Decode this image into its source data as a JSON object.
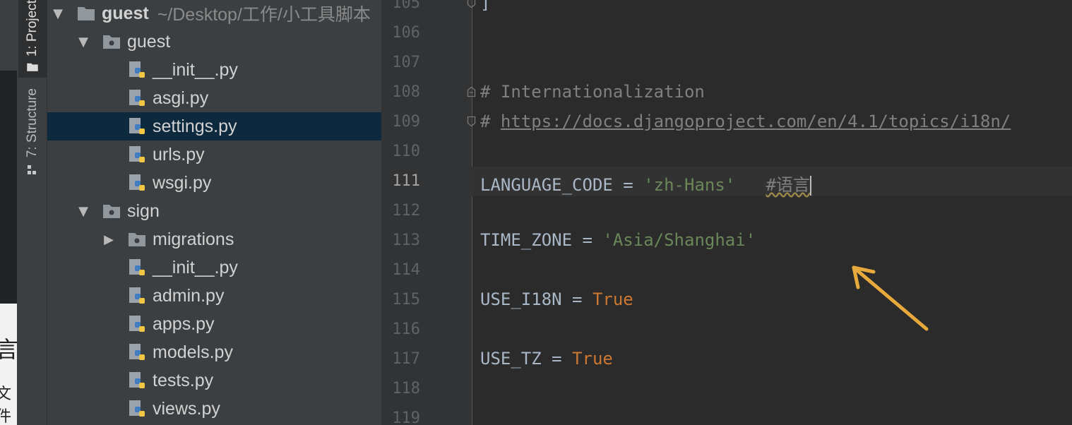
{
  "left_edge": {
    "glyph_top": "言",
    "glyph_bottom": "文件"
  },
  "tool_windows": [
    {
      "label": "1: Project",
      "active": true
    },
    {
      "label": "7: Structure",
      "active": false
    }
  ],
  "project_tree": {
    "root": {
      "name": "guest",
      "path": "~/Desktop/工作/小工具脚本"
    },
    "items": [
      {
        "name": "guest",
        "type": "package",
        "expanded": true
      },
      {
        "name": "__init__.py",
        "type": "python"
      },
      {
        "name": "asgi.py",
        "type": "python"
      },
      {
        "name": "settings.py",
        "type": "python",
        "selected": true
      },
      {
        "name": "urls.py",
        "type": "python"
      },
      {
        "name": "wsgi.py",
        "type": "python"
      },
      {
        "name": "sign",
        "type": "package",
        "expanded": true
      },
      {
        "name": "migrations",
        "type": "package",
        "expanded": false
      },
      {
        "name": "__init__.py",
        "type": "python"
      },
      {
        "name": "admin.py",
        "type": "python"
      },
      {
        "name": "apps.py",
        "type": "python"
      },
      {
        "name": "models.py",
        "type": "python"
      },
      {
        "name": "tests.py",
        "type": "python"
      },
      {
        "name": "views.py",
        "type": "python"
      }
    ]
  },
  "editor": {
    "current_line": "111",
    "line_numbers": [
      "105",
      "106",
      "107",
      "108",
      "109",
      "110",
      "111",
      "112",
      "113",
      "114",
      "115",
      "116",
      "117",
      "118",
      "119"
    ],
    "lines": {
      "l105": "]",
      "l108_comment": "# Internationalization",
      "l109_hash": "# ",
      "l109_url": "https://docs.djangoproject.com/en/4.1/topics/i18n/",
      "l111_name": "LANGUAGE_CODE",
      "l111_op": " = ",
      "l111_value": "'zh-Hans'",
      "l111_comment": "#语言",
      "l113_name": "TIME_ZONE",
      "l113_op": " = ",
      "l113_value": "'Asia/Shanghai'",
      "l115_name": "USE_I18N",
      "l115_op": " = ",
      "l115_value": "True",
      "l117_name": "USE_TZ",
      "l117_op": " = ",
      "l117_value": "True"
    }
  },
  "colors": {
    "editor_bg": "#2b2b2b",
    "panel_bg": "#3c3f41",
    "selection": "#0d293e",
    "string": "#6a8759",
    "keyword": "#cc7832",
    "comment": "#808080",
    "identifier": "#a9b7c6",
    "annotation_arrow": "#e8a93c"
  }
}
